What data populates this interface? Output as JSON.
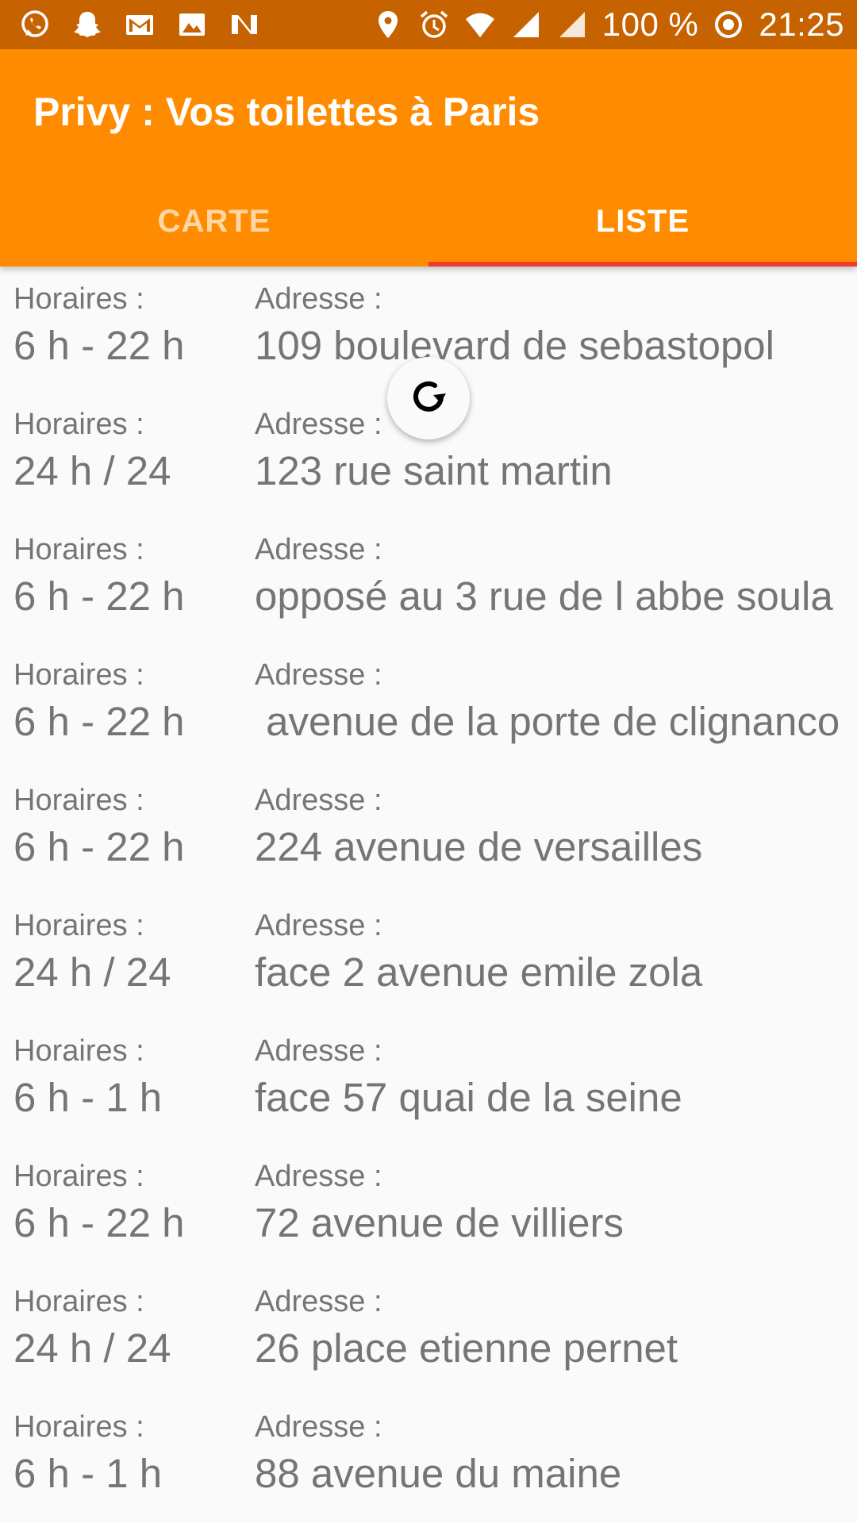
{
  "status_bar": {
    "left_icons": [
      "whatsapp-icon",
      "snapchat-icon",
      "gmail-icon",
      "gallery-icon",
      "n-app-icon"
    ],
    "right_icons": [
      "location-icon",
      "alarm-icon",
      "wifi-icon",
      "signal-icon"
    ],
    "battery": "100 %",
    "time": "21:25"
  },
  "app_bar": {
    "title": "Privy : Vos toilettes à Paris",
    "background": "#ff8c00"
  },
  "tabs": [
    {
      "label": "CARTE",
      "active": false
    },
    {
      "label": "LISTE",
      "active": true
    }
  ],
  "list": {
    "hours_label": "Horaires :",
    "address_label": "Adresse :",
    "items": [
      {
        "hours": "6 h - 22 h",
        "address": "109 boulevard de sebastopol"
      },
      {
        "hours": "24 h / 24",
        "address": "123 rue saint martin"
      },
      {
        "hours": "6 h - 22 h",
        "address": "opposé au 3 rue de l abbe soula"
      },
      {
        "hours": "6 h - 22 h",
        "address": " avenue de la porte de clignanco"
      },
      {
        "hours": "6 h - 22 h",
        "address": "224 avenue de versailles"
      },
      {
        "hours": "24 h / 24",
        "address": "face 2 avenue emile zola"
      },
      {
        "hours": "6 h - 1 h",
        "address": "face 57 quai de la seine"
      },
      {
        "hours": "6 h - 22 h",
        "address": "72 avenue de villiers"
      },
      {
        "hours": "24 h / 24",
        "address": "26 place etienne pernet"
      },
      {
        "hours": "6 h - 1 h",
        "address": "88 avenue du maine"
      }
    ]
  },
  "refresh_icon": "refresh-icon"
}
